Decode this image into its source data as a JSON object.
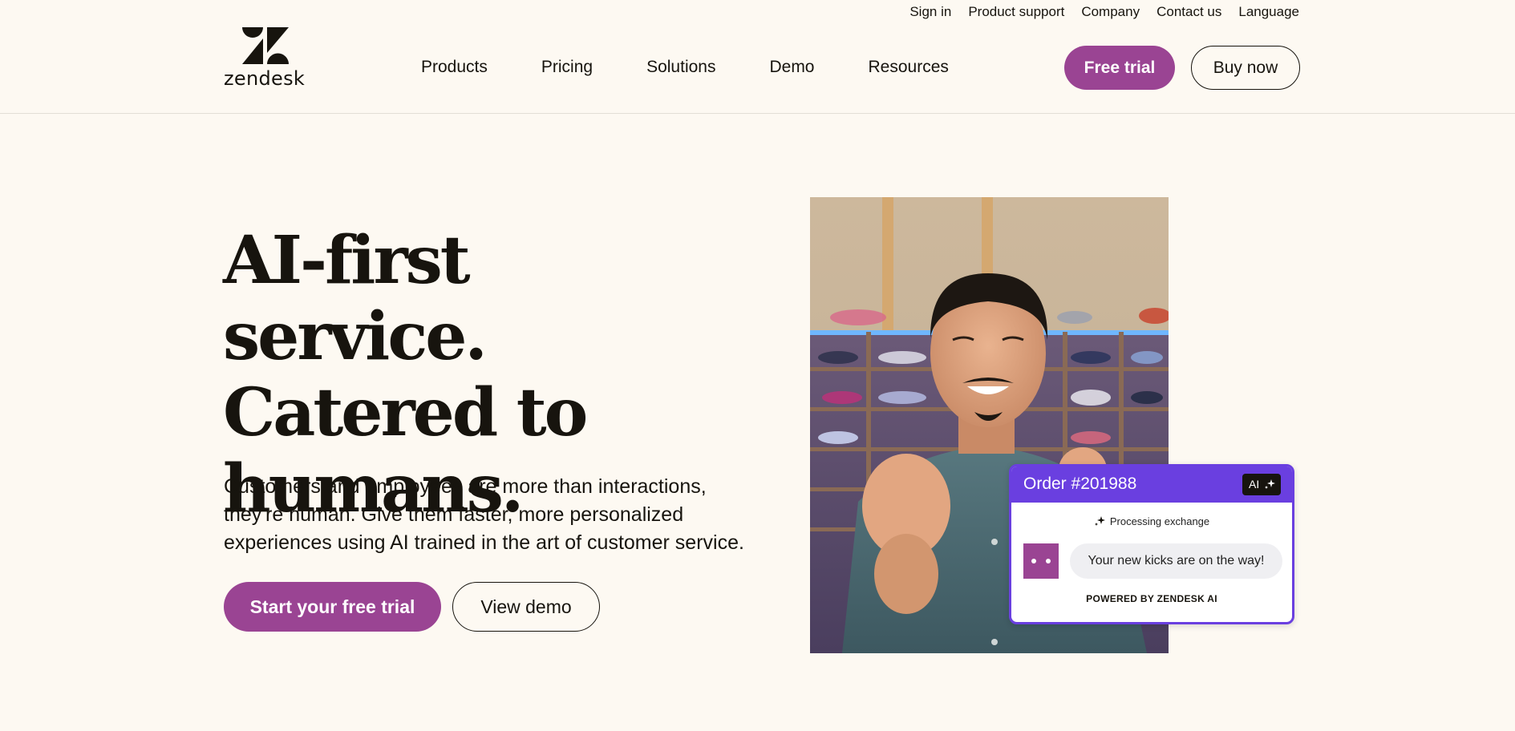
{
  "brand": {
    "name": "zendesk",
    "primary_color": "#9a4493",
    "card_accent_color": "#6a3fe0",
    "background_color": "#fdf9f2",
    "text_color": "#17140e"
  },
  "utility_nav": [
    {
      "label": "Sign in"
    },
    {
      "label": "Product support"
    },
    {
      "label": "Company"
    },
    {
      "label": "Contact us"
    },
    {
      "label": "Language"
    }
  ],
  "main_nav": [
    {
      "label": "Products"
    },
    {
      "label": "Pricing"
    },
    {
      "label": "Solutions"
    },
    {
      "label": "Demo"
    },
    {
      "label": "Resources"
    }
  ],
  "header_buttons": {
    "free_trial": "Free trial",
    "buy_now": "Buy now"
  },
  "hero": {
    "title_lines": [
      "AI-first service.",
      "Catered to",
      "humans."
    ],
    "subtitle": "Customers and employees are more than interactions, they're human. Give them faster, more personalized experiences using AI trained in the art of customer service.",
    "primary_cta": "Start your free trial",
    "secondary_cta": "View demo",
    "image_icon": "photo-smiling-man-shoe-store"
  },
  "order_card": {
    "title": "Order #201988",
    "badge": "AI",
    "badge_icon": "sparkle-icon",
    "status": "Processing exchange",
    "status_icon": "sparkle-icon",
    "message": "Your new kicks are on the way!",
    "avatar_icon": "bot-avatar-icon",
    "footer": "POWERED BY ZENDESK AI"
  }
}
